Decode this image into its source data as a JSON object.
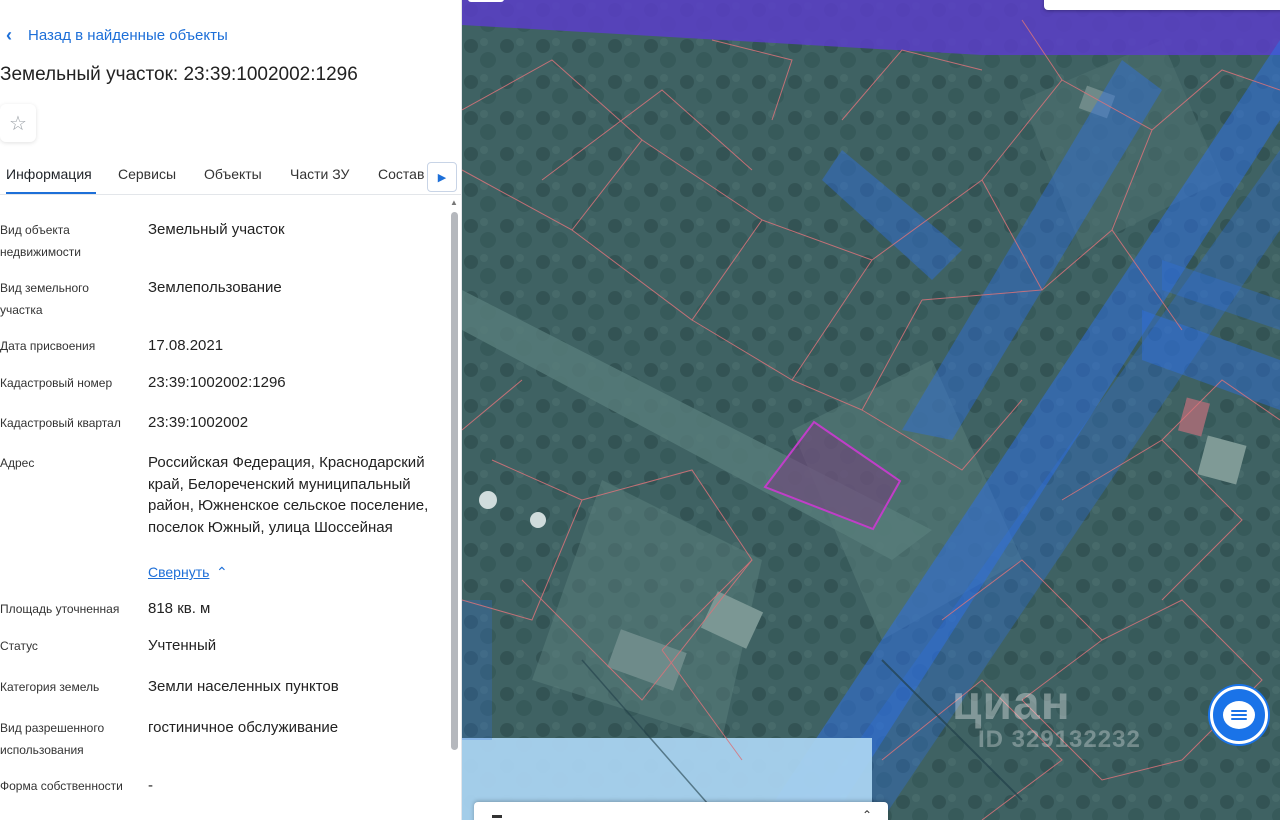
{
  "panel": {
    "back_label": "Назад в найденные объекты",
    "back_icon": "chevron-left-icon",
    "title": "Земельный участок: 23:39:1002002:1296",
    "favorite_icon": "star-outline-icon",
    "tabs": [
      {
        "label": "Информация",
        "active": true
      },
      {
        "label": "Сервисы",
        "active": false
      },
      {
        "label": "Объекты",
        "active": false
      },
      {
        "label": "Части ЗУ",
        "active": false
      },
      {
        "label": "Состав",
        "active": false
      }
    ],
    "tabs_next_icon": "triangle-right-icon",
    "fields": [
      {
        "label": "Вид объекта недвижимости",
        "value": "Земельный участок"
      },
      {
        "label": "Вид земельного участка",
        "value": "Землепользование"
      },
      {
        "label": "Дата присвоения",
        "value": "17.08.2021"
      },
      {
        "label": "Кадастровый номер",
        "value": "23:39:1002002:1296"
      },
      {
        "label": "Кадастровый квартал",
        "value": "23:39:1002002"
      },
      {
        "label": "Адрес",
        "value": "Российская Федерация, Краснодарский край, Белореченский муниципальный район, Южненское сельское поселение, поселок Южный, улица Шоссейная"
      },
      {
        "label": "Площадь уточненная",
        "value": "818 кв. м"
      },
      {
        "label": "Статус",
        "value": "Учтенный"
      },
      {
        "label": "Категория земель",
        "value": "Земли населенных пунктов"
      },
      {
        "label": "Вид разрешенного использования",
        "value": "гостиничное обслуживание"
      },
      {
        "label": "Форма собственности",
        "value": "-"
      }
    ],
    "collapse_label": "Свернуть",
    "collapse_icon": "chevron-up-icon"
  },
  "map": {
    "watermark": "циан",
    "watermark_id": "ID 329132232",
    "chat_icon": "chat-bubble-icon",
    "highlight_color": "#c03ec8",
    "road_color": "#2f6fe0",
    "zone_color": "#5a3ec8",
    "parcel_line_color": "#d9737a"
  }
}
